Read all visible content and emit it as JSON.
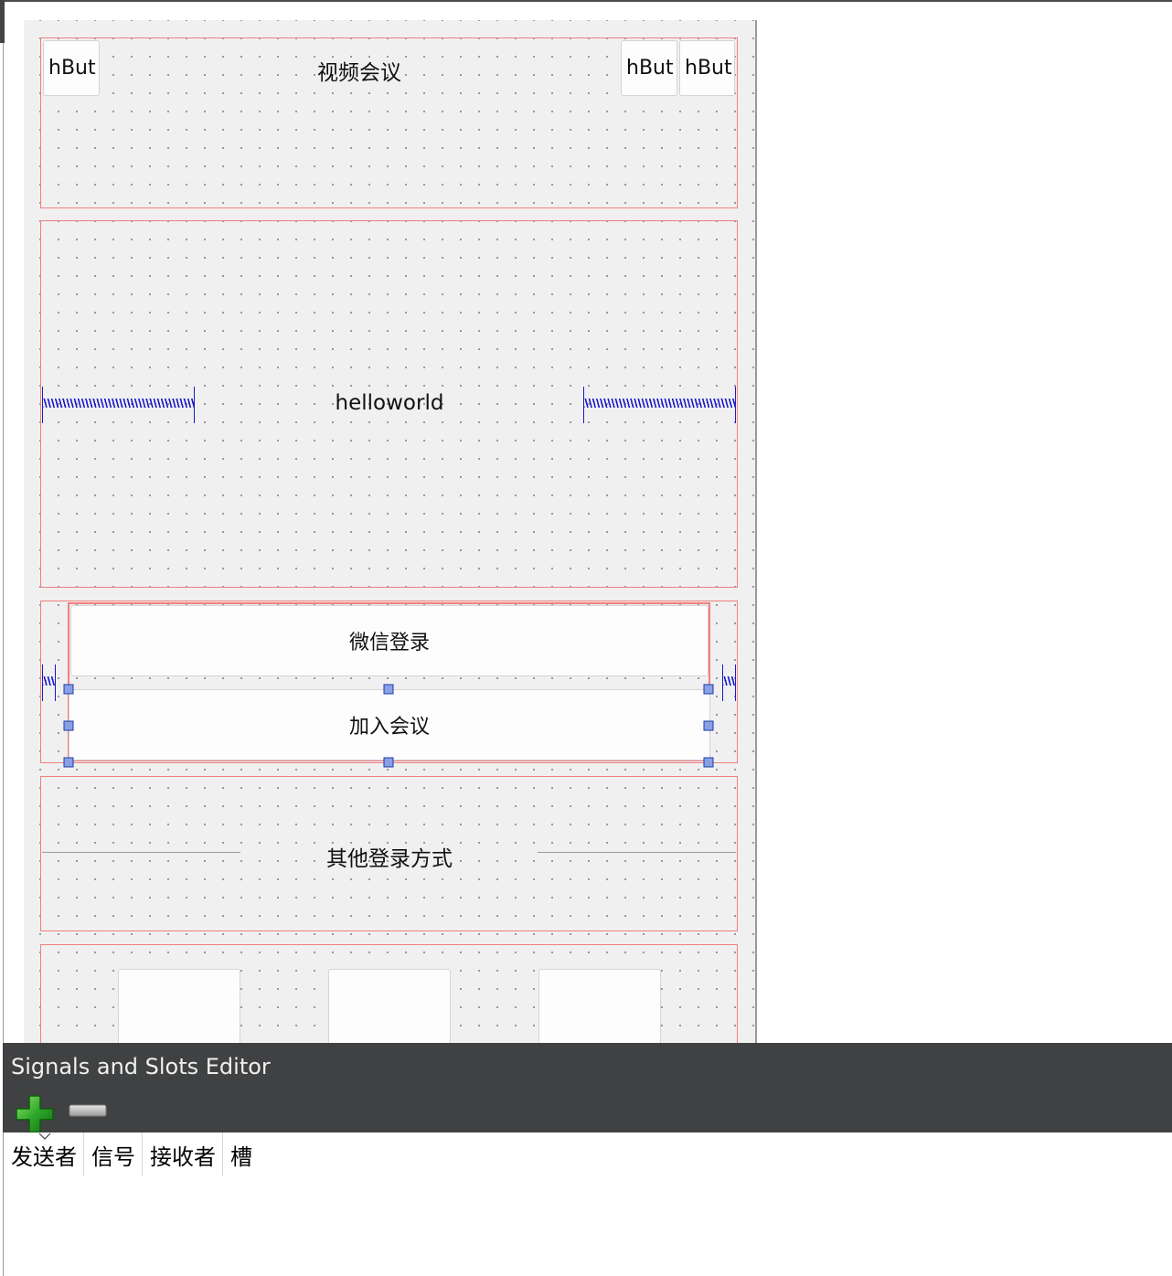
{
  "form": {
    "title_label": "视频会议",
    "top_buttons": [
      "hBut",
      "hBut",
      "hBut"
    ],
    "hello_label": "helloworld",
    "wechat_login_button": "微信登录",
    "join_meeting_button": "加入会议",
    "other_login_label": "其他登录方式",
    "bottom_buttons": [
      "...",
      "...",
      "..."
    ]
  },
  "dock": {
    "title": "Signals and Slots Editor",
    "add_icon": "plus-icon",
    "remove_icon": "minus-icon",
    "columns": [
      "发送者",
      "信号",
      "接收者",
      "槽"
    ]
  },
  "colors": {
    "layout_border": "#ef8080",
    "spacer": "#1a1acc",
    "dock_titlebar": "#404142",
    "canvas_bg": "#f0f0f0"
  }
}
